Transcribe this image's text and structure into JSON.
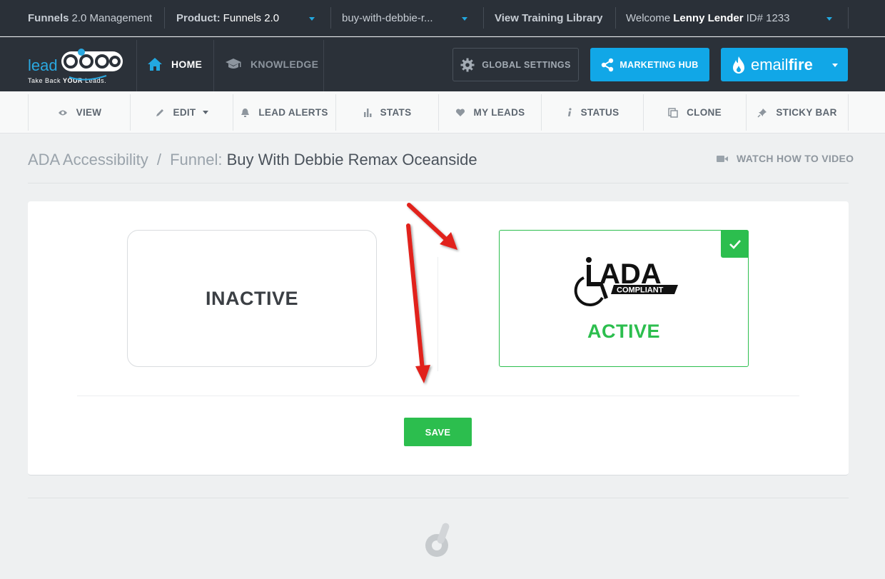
{
  "topbar": {
    "app_bold": "Funnels",
    "app_rest": "2.0 Management",
    "product_label": "Product:",
    "product_value": "Funnels 2.0",
    "funnel_value": "buy-with-debbie-r...",
    "training": "View Training Library",
    "welcome": "Welcome",
    "user_name": "Lenny Lender",
    "user_id": "ID# 1233"
  },
  "logo": {
    "word": "lead",
    "tagline_pre": "Take Back",
    "tagline_bold": "YOUR",
    "tagline_post": "Leads."
  },
  "nav": {
    "home": "HOME",
    "knowledge": "KNOWLEDGE",
    "global_settings": "GLOBAL SETTINGS",
    "marketing_hub": "MARKETING HUB",
    "email_pre": "email",
    "email_bold": "fire"
  },
  "subnav": {
    "view": "VIEW",
    "edit": "EDIT",
    "lead_alerts": "LEAD ALERTS",
    "stats": "STATS",
    "my_leads": "MY LEADS",
    "status": "STATUS",
    "clone": "CLONE",
    "sticky_bar": "STICKY BAR"
  },
  "breadcrumb": {
    "section": "ADA Accessibility",
    "sep": "/",
    "label": "Funnel:",
    "current": "Buy With Debbie Remax Oceanside"
  },
  "watch_video": "WATCH HOW TO VIDEO",
  "options": {
    "inactive": "INACTIVE",
    "active": "ACTIVE",
    "selected": "active",
    "ada_logo_text": "ADA",
    "ada_logo_sub": "COMPLIANT"
  },
  "save_label": "SAVE",
  "colors": {
    "topbar_bg": "#2a3038",
    "navbar_bg": "#2b3139",
    "accent_blue": "#11a7e7",
    "active_green": "#2cbe4e",
    "annotation_red": "#e1201b"
  },
  "icons": {
    "home": "home-icon",
    "knowledge": "graduation-cap-icon",
    "global_settings": "gear-icon",
    "marketing_hub": "share-icon",
    "email_fire": "flame-icon",
    "view": "eye-icon",
    "edit": "pencil-icon",
    "lead_alerts": "bell-icon",
    "stats": "bar-chart-icon",
    "my_leads": "heart-icon",
    "status": "info-icon",
    "clone": "copy-icon",
    "sticky_bar": "pin-icon",
    "watch_video": "video-camera-icon",
    "selected": "checkmark-icon",
    "footer": "leadpops-mark-icon"
  }
}
